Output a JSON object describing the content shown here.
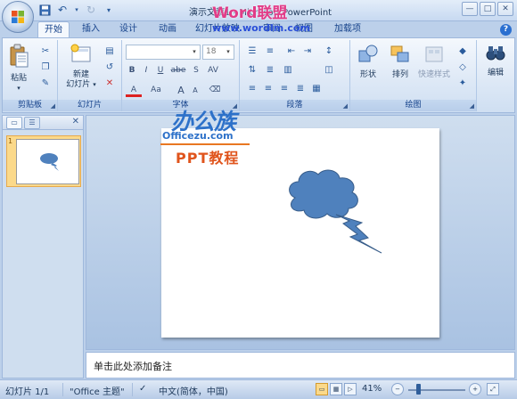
{
  "titlebar": {
    "title": "演示文稿1 - Microsoft PowerPoint",
    "watermark_top": "Word联盟",
    "watermark_url": "www.wordlm.com",
    "window_buttons": [
      "—",
      "□",
      "✕"
    ]
  },
  "tabs": [
    "开始",
    "插入",
    "设计",
    "动画",
    "幻灯片放映",
    "审阅",
    "视图",
    "加载项"
  ],
  "active_tab": "开始",
  "ribbon": {
    "groups": {
      "clipboard": {
        "label": "剪贴板",
        "paste": "粘贴"
      },
      "slides": {
        "label": "幻灯片",
        "new_slide_line1": "新建",
        "new_slide_line2": "幻灯片"
      },
      "font": {
        "label": "字体",
        "font_size": "18",
        "bold": "B",
        "italic": "I",
        "underline": "U",
        "strike": "abe",
        "shadow": "S",
        "spacing": "AV",
        "grow": "A",
        "shrink": "A",
        "color": "A",
        "case": "Aa"
      },
      "paragraph": {
        "label": "段落"
      },
      "drawing": {
        "label": "绘图",
        "shape": "形状",
        "arrange": "排列",
        "quick_style": "快速样式"
      },
      "editing": {
        "label": "编辑"
      }
    }
  },
  "panel": {
    "slide_number": "1"
  },
  "slide_content": {
    "brand_cn": "办公族",
    "brand_en": "Officezu.com",
    "brand_sub": "PPT教程"
  },
  "notes": {
    "placeholder": "单击此处添加备注"
  },
  "status": {
    "slide_info": "幻灯片 1/1",
    "theme": "\"Office 主题\"",
    "language": "中文(简体，中国)",
    "zoom": "41%",
    "zoom_level": 0.41
  },
  "colors": {
    "accent": "#15428b",
    "shape_fill": "#4f81bd",
    "shape_stroke": "#385d8a"
  }
}
